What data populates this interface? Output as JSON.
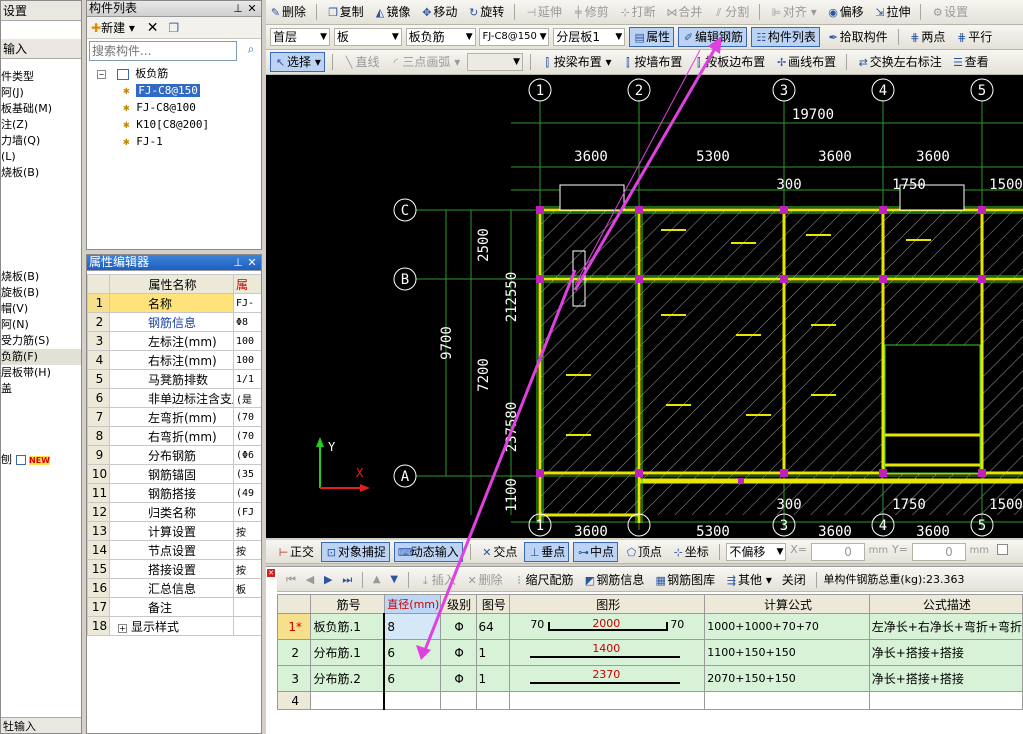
{
  "left_nav": {
    "top_items": [
      "设置",
      "输入"
    ],
    "items": [
      "件类型",
      "阿(J)",
      "板基础(M)",
      "注(Z)",
      "力墙(Q)",
      "(L)",
      "烧板(B)"
    ],
    "items2": [
      "烧板(B)",
      "旋板(B)",
      "帽(V)",
      "阿(N)",
      "受力筋(S)",
      "负筋(F)",
      "层板带(H)",
      "盖"
    ],
    "new_item": "刨",
    "new_badge": "NEW",
    "bottom_item": "牡输入"
  },
  "component_list": {
    "title": "构件列表",
    "new_label": "新建",
    "search_placeholder": "搜索构件...",
    "root": "板负筋",
    "items": [
      "FJ-C8@150",
      "FJ-C8@100",
      "K10[C8@200]",
      "FJ-1"
    ]
  },
  "property_editor": {
    "title": "属性编辑器",
    "col_name": "属性名称",
    "col_value": "属",
    "rows": [
      {
        "no": "1",
        "name": "名称",
        "value": "FJ-"
      },
      {
        "no": "2",
        "name": "钢筋信息",
        "value": "Φ8"
      },
      {
        "no": "3",
        "name": "左标注(mm)",
        "value": "100"
      },
      {
        "no": "4",
        "name": "右标注(mm)",
        "value": "100"
      },
      {
        "no": "5",
        "name": "马凳筋排数",
        "value": "1/1"
      },
      {
        "no": "6",
        "name": "非单边标注含支座",
        "value": "(是"
      },
      {
        "no": "7",
        "name": "左弯折(mm)",
        "value": "(70"
      },
      {
        "no": "8",
        "name": "右弯折(mm)",
        "value": "(70"
      },
      {
        "no": "9",
        "name": "分布钢筋",
        "value": "(Φ6"
      },
      {
        "no": "10",
        "name": "钢筋锚固",
        "value": "(35"
      },
      {
        "no": "11",
        "name": "钢筋搭接",
        "value": "(49"
      },
      {
        "no": "12",
        "name": "归类名称",
        "value": "(FJ"
      },
      {
        "no": "13",
        "name": "计算设置",
        "value": "按"
      },
      {
        "no": "14",
        "name": "节点设置",
        "value": "按"
      },
      {
        "no": "15",
        "name": "搭接设置",
        "value": "按"
      },
      {
        "no": "16",
        "name": "汇总信息",
        "value": "板"
      },
      {
        "no": "17",
        "name": "备注",
        "value": ""
      },
      {
        "no": "18",
        "name": "显示样式",
        "value": ""
      }
    ]
  },
  "toolbar1": [
    "删除",
    "复制",
    "镜像",
    "移动",
    "旋转",
    "延伸",
    "修剪",
    "打断",
    "合并",
    "分割",
    "对齐",
    "偏移",
    "拉伸",
    "设置"
  ],
  "toolbar2": {
    "floor": "首层",
    "type": "板",
    "subtype": "板负筋",
    "component": "FJ-C8@150",
    "layer": "分层板1",
    "buttons": [
      "属性",
      "编辑钢筋",
      "构件列表",
      "拾取构件",
      "两点",
      "平行"
    ]
  },
  "toolbar3": [
    "选择",
    "直线",
    "三点画弧",
    "按梁布置",
    "按墙布置",
    "按板边布置",
    "画线布置",
    "交换左右标注",
    "查看"
  ],
  "cad": {
    "axes_top": [
      "1",
      "2",
      "3",
      "4",
      "5"
    ],
    "axes_left": [
      "C",
      "B",
      "A"
    ],
    "dims_top_total": "19700",
    "dims_top": [
      "3600",
      "5300",
      "3600",
      "3600",
      "1500"
    ],
    "dims_top2": [
      "300",
      "1750",
      "1500"
    ],
    "dims_left": [
      "2500",
      "212550",
      "9700",
      "7200",
      "237580",
      "1100"
    ],
    "dims_bottom": [
      "3600",
      "5300",
      "3600",
      "3600"
    ],
    "dims_bottom2": [
      "300",
      "1750",
      "1500"
    ],
    "ucs_y": "Y",
    "ucs_x": "X"
  },
  "snapbar": {
    "items": [
      "正交",
      "对象捕捉",
      "动态输入",
      "交点",
      "垂点",
      "中点",
      "顶点",
      "坐标"
    ],
    "offset_mode": "不偏移",
    "x_label": "X=",
    "x_value": "0",
    "y_label": "Y=",
    "y_value": "0",
    "unit": "mm"
  },
  "rebar_toolbar": {
    "items": [
      "插入",
      "删除",
      "缩尺配筋",
      "钢筋信息",
      "钢筋图库",
      "其他",
      "关闭"
    ],
    "total": "单构件钢筋总重(kg):23.363"
  },
  "rebar_table": {
    "headers": [
      "筋号",
      "直径(mm)",
      "级别",
      "图号",
      "图形",
      "计算公式",
      "公式描述"
    ],
    "rows": [
      {
        "no": "1*",
        "name": "板负筋.1",
        "dia": "8",
        "grade": "Φ",
        "fig": "64",
        "shape_left": "70",
        "shape_len": "2000",
        "shape_right": "70",
        "formula": "1000+1000+70+70",
        "desc": "左净长+右净长+弯折+弯折"
      },
      {
        "no": "2",
        "name": "分布筋.1",
        "dia": "6",
        "grade": "Φ",
        "fig": "1",
        "shape_left": "",
        "shape_len": "1400",
        "shape_right": "",
        "formula": "1100+150+150",
        "desc": "净长+搭接+搭接"
      },
      {
        "no": "3",
        "name": "分布筋.2",
        "dia": "6",
        "grade": "Φ",
        "fig": "1",
        "shape_left": "",
        "shape_len": "2370",
        "shape_right": "",
        "formula": "2070+150+150",
        "desc": "净长+搭接+搭接"
      },
      {
        "no": "4",
        "name": "",
        "dia": "",
        "grade": "",
        "fig": "",
        "shape_left": "",
        "shape_len": "",
        "shape_right": "",
        "formula": "",
        "desc": ""
      }
    ]
  }
}
